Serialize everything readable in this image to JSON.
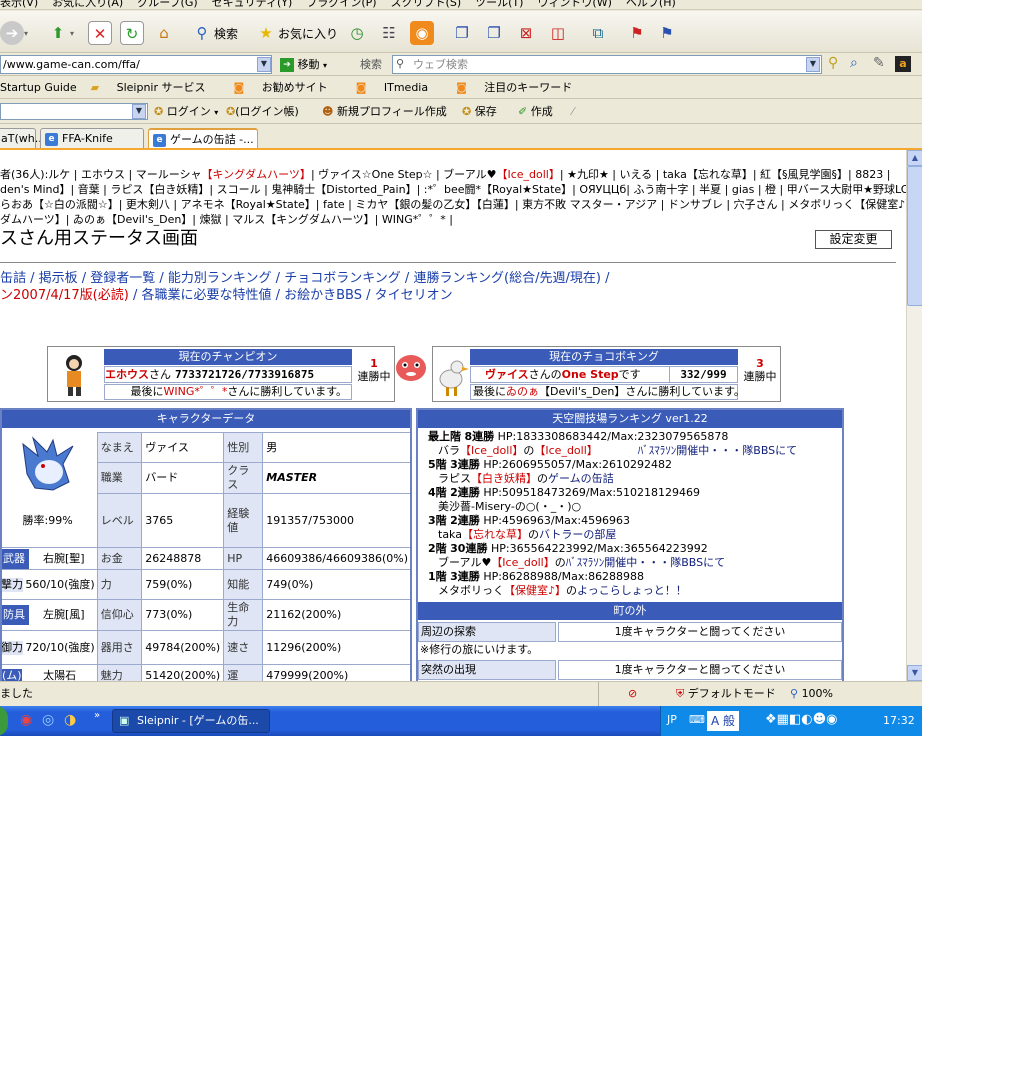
{
  "menubar": {
    "items": [
      "表示(V)",
      "お気に入り(A)",
      "グループ(G)",
      "セキュリティ(Y)",
      "プラグイン(P)",
      "スクリプト(S)",
      "ツール(T)",
      "ウィンドウ(W)",
      "ヘルプ(H)"
    ]
  },
  "toolbar": {
    "search_label": "検索",
    "favorites_label": "お気に入り"
  },
  "address": {
    "url": "/www.game-can.com/ffa/",
    "go_label": "移動",
    "search_prefix": "検索",
    "search_placeholder": "ウェブ検索"
  },
  "links": {
    "items": [
      "Startup Guide",
      "Sleipnir サービス",
      "お勧めサイト",
      "ITmedia",
      "注目のキーワード"
    ]
  },
  "toolbar2": {
    "login": "ログイン",
    "login_account": "(ログイン帳)",
    "new_profile": "新規プロフィール作成",
    "save": "保存",
    "create": "作成"
  },
  "tabs": [
    {
      "label": "aT(wh..."
    },
    {
      "label": "FFA-Knife"
    },
    {
      "label": "ゲームの缶詰 -..."
    }
  ],
  "online": {
    "line1_prefix": "者(36人):",
    "line1": "ルケ | エホウス | マールーシャ",
    "line1_red": "【キングダムハーツ】",
    "line1b": "| ヴァイス☆One Step☆ | ブーアル♥",
    "line1b_red": "【Ice_doll】",
    "line1c": "| ★九印★ | いえる | taka【忘れな草】| 紅【§風見学園§】| 8823 |",
    "line2": "den's Mind】| 音葉 | ラピス【白き妖精】| スコール | 鬼神騎士【Distorted_Pain】| :*゜bee闘*【Royal★State】| ОЯУЦЦб| ふう南十字 | 半夏 | gias | 橙 | 甲バース大尉甲★野球LO",
    "line3": "らおあ【☆白の派閥☆】| 更木剣八 | アネモネ【Royal★State】| fate | ミカヤ【銀の髪の乙女】【白蓮】| 東方不敗 マスター・アジア | ドンサブレ | 穴子さん | メタボリっく【保健室♪】|",
    "line4": "ダムハーツ】| ゐのぁ【Devil's_Den】| 煉獄 | マルス【キングダムハーツ】| WING*゜゜* |"
  },
  "page_title": "スさん用ステータス画面",
  "settings_button": "設定変更",
  "nav": {
    "line1": "缶詰 / 掲示板 / 登録者一覧 / 能力別ランキング / チョコボランキング / 連勝ランキング(総合/先週/現在) /",
    "line2_red": "ン2007/4/17版(必読)",
    "line2": "/ 各職業に必要な特性値 / お絵かきBBS / タイセリオン"
  },
  "champion": {
    "header": "現在のチャンピオン",
    "name": "エホウス",
    "san": "さん",
    "score": "7733721726/7733916875",
    "wins": "1",
    "wins_label": "連勝中",
    "last_prefix": "最後に",
    "last_name": "WING*゜゜*",
    "last_suffix": "さんに勝利しています。"
  },
  "choco": {
    "header": "現在のチョコボキング",
    "owner": "ヴァイス",
    "owner_mid": "さんの",
    "bird": "One Step",
    "desu": "です",
    "score": "332/999",
    "wins": "3",
    "wins_label": "連勝中",
    "last_prefix": "最後に",
    "last_name": "ゐのぁ",
    "last_suffix": "【Devil's_Den】さんに勝利しています。"
  },
  "chardata": {
    "header": "キャラクターデータ",
    "winrate": "勝率:99%",
    "rows": [
      [
        "なまえ",
        "ヴァイス",
        "性別",
        "男"
      ],
      [
        "職業",
        "バード",
        "クラス",
        "MASTER"
      ],
      [
        "レベル",
        "3765",
        "経験値",
        "191357/753000"
      ]
    ],
    "weapon_tag": "武器",
    "weapon": "右腕[聖]",
    "money_label": "お金",
    "money": "26248878",
    "hp_label": "HP",
    "hp": "46609386/46609386(0%)",
    "atk_label": "撃力",
    "atk": "560/10(強度)",
    "str_label": "力",
    "str": "759(0%)",
    "int_label": "知能",
    "int": "749(0%)",
    "armor_tag": "防具",
    "armor": "左腕[風]",
    "faith_label": "信仰心",
    "faith": "773(0%)",
    "vit_label": "生命力",
    "vit": "21162(200%)",
    "def_label": "御力",
    "def": "720/10(強度)",
    "dex_label": "器用さ",
    "dex": "49784(200%)",
    "spd_label": "速さ",
    "spd": "11296(200%)",
    "row_cut": [
      "(ム)",
      "太陽石",
      "魅力",
      "51420(200%)",
      "運",
      "479999(200%)"
    ]
  },
  "ranking": {
    "header": "天空闘技場ランキング ver1.22",
    "entries": [
      {
        "floor": "最上階",
        "streak": "8連勝",
        "hp": "HP:1833308683442/Max:2323079565878",
        "who": "バラ",
        "guild": "【Ice_doll】",
        "of": "の",
        "place": "【Ice_doll】",
        "note": "ﾊﾞｽﾏﾗｿﾝ開催中・・・隊BBSにて"
      },
      {
        "floor": "5階",
        "streak": "3連勝",
        "hp": "HP:2606955057/Max:2610292482",
        "who": "ラピス",
        "guild": "【白き妖精】",
        "of": "の",
        "place": "ゲームの缶詰",
        "note": ""
      },
      {
        "floor": "4階",
        "streak": "2連勝",
        "hp": "HP:509518473269/Max:510218129469",
        "who": "美沙薔-Misery-の○(・_・)○",
        "guild": "",
        "of": "",
        "place": "",
        "note": ""
      },
      {
        "floor": "3階",
        "streak": "2連勝",
        "hp": "HP:4596963/Max:4596963",
        "who": "taka",
        "guild": "【忘れな草】",
        "of": "の",
        "place": "バトラーの部屋",
        "note": ""
      },
      {
        "floor": "2階",
        "streak": "30連勝",
        "hp": "HP:365564223992/Max:365564223992",
        "who": "ブーアル♥",
        "guild": "【Ice_doll】",
        "of": "の",
        "place": "ﾊﾞｽﾏﾗｿﾝ開催中・・・隊BBSにて",
        "note": ""
      },
      {
        "floor": "1階",
        "streak": "3連勝",
        "hp": "HP:86288988/Max:86288988",
        "who": "メタボリっく",
        "guild": "【保健室♪】",
        "of": "の",
        "place": "よっこらしょっと！！",
        "note": ""
      }
    ]
  },
  "town": {
    "header": "町の外",
    "explore_label": "周辺の探索",
    "explore_value": "1度キャラクターと闘ってください",
    "training": "※修行の旅にいけます。",
    "sudden_label": "突然の出現",
    "sudden_value": "1度キャラクターと闘ってください"
  },
  "status": {
    "text": "ました",
    "mode": "デフォルトモード",
    "zoom": "100%"
  },
  "taskbar": {
    "window": "Sleipnir - [ゲームの缶...",
    "lang": "JP",
    "ime": "A 般",
    "time": "17:32"
  }
}
